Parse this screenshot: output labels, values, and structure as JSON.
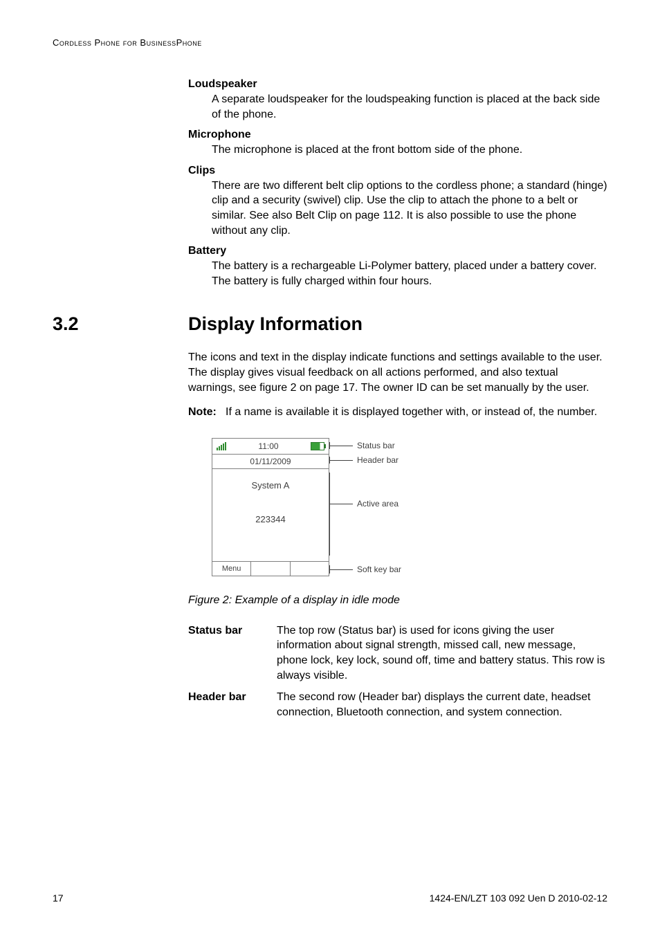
{
  "running_header": "Cordless Phone for BusinessPhone",
  "items": [
    {
      "term": "Loudspeaker",
      "defn": "A separate loudspeaker for the loudspeaking function is placed at the back side of the phone."
    },
    {
      "term": "Microphone",
      "defn": "The microphone is placed at the front bottom side of the phone."
    },
    {
      "term": "Clips",
      "defn": "There are two different belt clip options to the cordless phone; a standard (hinge) clip and a security (swivel) clip. Use the clip to attach the phone to a belt or similar. See also Belt Clip on page 112. It is also possible to use the phone without any clip."
    },
    {
      "term": "Battery",
      "defn": "The battery is a rechargeable Li-Polymer battery, placed under a battery cover. The battery is fully charged within four hours."
    }
  ],
  "section": {
    "num": "3.2",
    "title": "Display Information"
  },
  "intro": "The icons and text in the display indicate functions and settings available to the user. The display gives visual feedback on all actions performed, and also textual warnings, see figure 2 on page 17. The owner ID can be set manually by the user.",
  "note": {
    "label": "Note:",
    "text": "If a name is available it is displayed together with, or instead of, the number."
  },
  "diagram": {
    "time": "11:00",
    "date": "01/11/2009",
    "system": "System A",
    "owner": "223344",
    "softkey": "Menu",
    "callouts": {
      "status": "Status bar",
      "header": "Header bar",
      "active": "Active area",
      "softkey": "Soft key bar"
    }
  },
  "fig_caption": "Figure 2:  Example of a display in idle mode",
  "defs": [
    {
      "term": "Status bar",
      "text": "The top row (Status bar) is used for icons giving the user information about signal strength, missed call, new message, phone lock, key lock, sound off, time and battery status. This row is always visible."
    },
    {
      "term": "Header bar",
      "text": "The second row (Header bar) displays the current date, headset connection, Bluetooth connection, and system connection."
    }
  ],
  "footer": {
    "page": "17",
    "docid": "1424-EN/LZT 103 092 Uen D 2010-02-12"
  }
}
